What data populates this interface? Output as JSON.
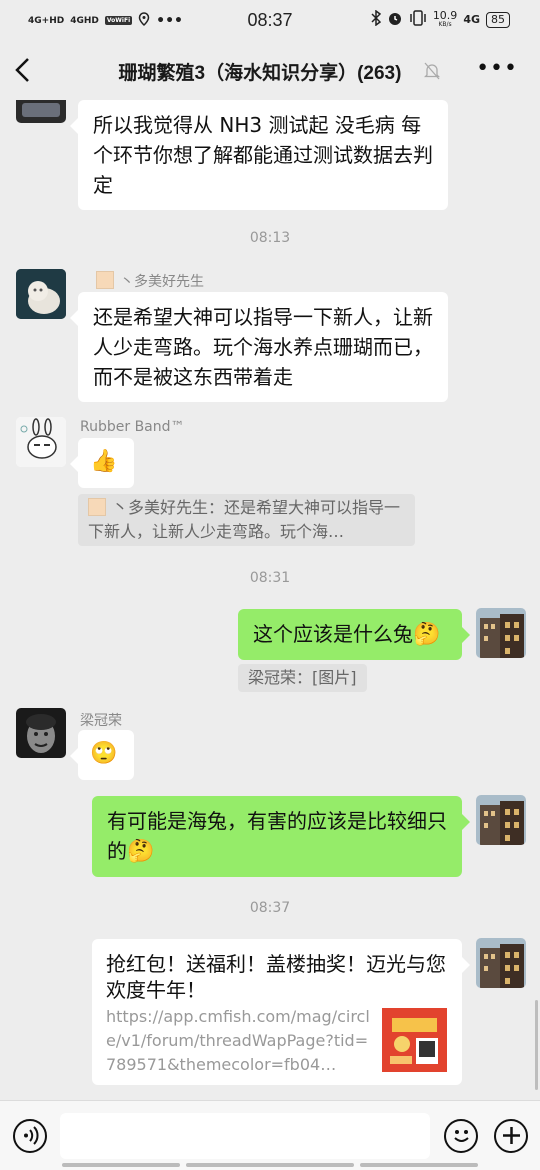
{
  "status_bar": {
    "time": "08:37",
    "left_icons": [
      "4G+HD",
      "4GHD",
      "VoWiFi",
      "location-icon",
      "more-dots"
    ],
    "net_speed": "10.9",
    "net_speed_unit": "KB/s",
    "network": "4G",
    "battery": "85"
  },
  "nav": {
    "title": "珊瑚繁殖3（海水知识分享）(263)",
    "back_icon": "chevron-left-icon",
    "mute_icon": "bell-off-icon",
    "more_icon": "more-dots-icon"
  },
  "messages": {
    "m1_text": "所以我觉得从 NH3 测试起 没毛病 每个环节你想了解都能通过测试数据去判定",
    "ts1": "08:13",
    "m2_sender": "丶多美好先生",
    "m2_text": "还是希望大神可以指导一下新人，让新人少走弯路。玩个海水养点珊瑚而已，而不是被这东西带着走",
    "m3_sender": "Rubber Band™",
    "m3_emoji": "👍",
    "m3_quote": "丶多美好先生：还是希望大神可以指导一下新人，让新人少走弯路。玩个海…",
    "ts2": "08:31",
    "m4_text": "这个应该是什么兔",
    "m4_emoji": "🤔",
    "m4_quote": "梁冠荣：[图片]",
    "m5_sender": "梁冠荣",
    "m5_emoji": "🙄",
    "m6_text": "有可能是海兔，有害的应该是比较细只的",
    "m6_emoji": "🤔",
    "ts3": "08:37",
    "link_title": "抢红包！送福利！盖楼抽奖！迈光与您欢度牛年！",
    "link_url": "https://app.cmfish.com/mag/circle/v1/forum/threadWapPage?tid=789571&themecolor=fb04…"
  },
  "bottom": {
    "voice_icon": "voice-icon",
    "emoji_icon": "smile-icon",
    "plus_icon": "plus-icon"
  },
  "colors": {
    "background": "#ededed",
    "self_bubble": "#95ec69",
    "other_bubble": "#ffffff"
  }
}
